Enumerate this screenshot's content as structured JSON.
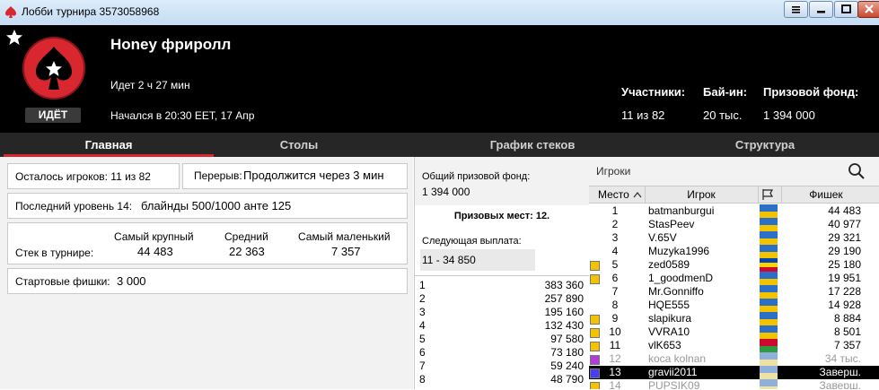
{
  "window": {
    "title": "Лобби турнира 3573058968"
  },
  "header": {
    "tournament_name": "Honey фриролл",
    "status_badge": "ИДЁТ",
    "running_time": "Идет 2 ч 27 мин",
    "started": "Начался в 20:30 EET, 17 Апр",
    "participants_label": "Участники:",
    "participants_value": "11 из 82",
    "buyin_label": "Бай-ин:",
    "buyin_value": "20 тыс.",
    "prizepool_label": "Призовой фонд:",
    "prizepool_value": "1 394 000"
  },
  "tabs": [
    {
      "label": "Главная"
    },
    {
      "label": "Столы"
    },
    {
      "label": "График стеков"
    },
    {
      "label": "Структура"
    }
  ],
  "main": {
    "players_left": "Осталось игроков: 11 из 82",
    "break_label": "Перерыв:",
    "break_value": "Продолжится через 3 мин",
    "level_label": "Последний уровень 14:",
    "level_value": "блайнды 500/1000 анте 125",
    "stack_label": "Стек в турнире:",
    "largest_label": "Самый крупный",
    "largest_value": "44 483",
    "average_label": "Средний",
    "average_value": "22 363",
    "smallest_label": "Самый маленький",
    "smallest_value": "7 357",
    "start_chips_label": "Стартовые фишки:",
    "start_chips_value": "3 000"
  },
  "prizes": {
    "pool_label": "Общий призовой фонд:",
    "pool_value": "1 394 000",
    "places_paid": "Призовых мест: 12.",
    "next_payout_label": "Следующая выплата:",
    "next_payout_value": "11 - 34 850",
    "rows": [
      {
        "place": "1",
        "amount": "383 360"
      },
      {
        "place": "2",
        "amount": "257 890"
      },
      {
        "place": "3",
        "amount": "195 160"
      },
      {
        "place": "4",
        "amount": "132 430"
      },
      {
        "place": "5",
        "amount": "97 580"
      },
      {
        "place": "6",
        "amount": "73 180"
      },
      {
        "place": "7",
        "amount": "59 240"
      },
      {
        "place": "8",
        "amount": "48 790"
      }
    ]
  },
  "players": {
    "search_placeholder": "Игроки",
    "col_place": "Место",
    "col_player": "Игрок",
    "col_chips": "Фишек",
    "rows": [
      {
        "place": "1",
        "name": "batmanburgui",
        "chips": "44 483",
        "marker": "",
        "flag": [
          "#2b6fc7",
          "#f4c300"
        ],
        "state": "active"
      },
      {
        "place": "2",
        "name": "StasPeev",
        "chips": "40 977",
        "marker": "",
        "flag": [
          "#2b6fc7",
          "#f4c300"
        ],
        "state": "active"
      },
      {
        "place": "3",
        "name": "V.65V",
        "chips": "29 321",
        "marker": "",
        "flag": [
          "#2b6fc7",
          "#f4c300"
        ],
        "state": "active"
      },
      {
        "place": "4",
        "name": "Muzyka1996",
        "chips": "29 190",
        "marker": "",
        "flag": [
          "#2b6fc7",
          "#f4c300"
        ],
        "state": "active"
      },
      {
        "place": "5",
        "name": "zed0589",
        "chips": "25 180",
        "marker": "#f4c300",
        "flag": [
          "#0046ae",
          "#ffd200",
          "#cc092f"
        ],
        "state": "active"
      },
      {
        "place": "6",
        "name": "1_goodmenD",
        "chips": "19 951",
        "marker": "#f4c300",
        "flag": [
          "#2b6fc7",
          "#f4c300"
        ],
        "state": "active"
      },
      {
        "place": "7",
        "name": "Mr.Gonniffo",
        "chips": "17 228",
        "marker": "",
        "flag": [
          "#2b6fc7",
          "#f4c300"
        ],
        "state": "active"
      },
      {
        "place": "8",
        "name": "HQE555",
        "chips": "14 928",
        "marker": "",
        "flag": [
          "#2b6fc7",
          "#f4c300"
        ],
        "state": "active"
      },
      {
        "place": "9",
        "name": "slapikura",
        "chips": "8 884",
        "marker": "#f4c300",
        "flag": [
          "#2b6fc7",
          "#f4c300"
        ],
        "state": "active"
      },
      {
        "place": "10",
        "name": "VVRA10",
        "chips": "8 501",
        "marker": "#f4c300",
        "flag": [
          "#2b6fc7",
          "#f4c300"
        ],
        "state": "active"
      },
      {
        "place": "11",
        "name": "vlK653",
        "chips": "7 357",
        "marker": "#f4c300",
        "flag": [
          "#cc092f",
          "#2e9b3f"
        ],
        "state": "active"
      },
      {
        "place": "12",
        "name": "koca kolnan",
        "chips": "34 тыс.",
        "marker": "#b23cd6",
        "flag": [
          "#8fb0dd",
          "#efe1a2"
        ],
        "state": "out"
      },
      {
        "place": "13",
        "name": "gravii2011",
        "chips": "Заверш.",
        "marker": "#4a3cf0",
        "flag": [
          "#8fb0dd",
          "#efe1a2"
        ],
        "state": "selected"
      },
      {
        "place": "14",
        "name": "PUPSIK09",
        "chips": "Заверш.",
        "marker": "#f4c300",
        "flag": [
          "#8fb0dd",
          "#efe1a2"
        ],
        "state": "out"
      }
    ]
  },
  "colors": {
    "accent": "#d8272f",
    "header_bg": "#000000",
    "tabs_bg": "#262626",
    "selected_row": "#000000"
  }
}
